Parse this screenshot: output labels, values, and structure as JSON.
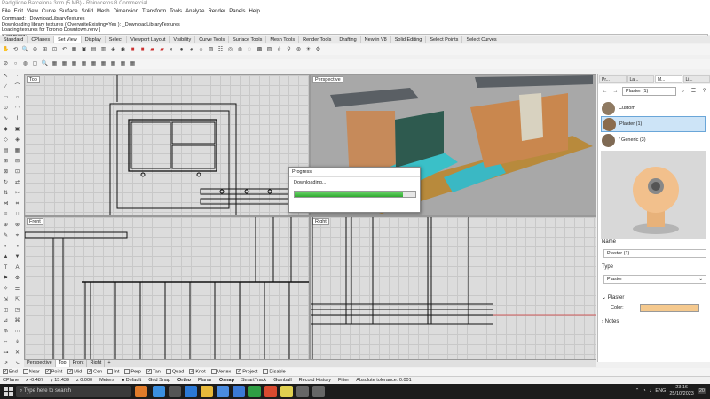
{
  "window": {
    "title": "Padiglione Barcelona 3dm (5 MB) - Rhinoceros 8 Commercial"
  },
  "menu": [
    "File",
    "Edit",
    "View",
    "Curve",
    "Surface",
    "Solid",
    "Mesh",
    "Dimension",
    "Transform",
    "Tools",
    "Analyze",
    "Render",
    "Panels",
    "Help"
  ],
  "command_history": [
    "Command: _DownloadLibraryTextures",
    "Downloading library textures ( OverwriteExisting=Yes ): _DownloadLibraryTextures",
    "Loading textures for Toronto Downtown.renv ]"
  ],
  "command_prompt": "Command:",
  "toolbar_tabs": [
    "Standard",
    "CPlanes",
    "Set View",
    "Display",
    "Select",
    "Viewport Layout",
    "Visibility",
    "Curve Tools",
    "Surface Tools",
    "Mesh Tools",
    "Render Tools",
    "Drafting",
    "New in V8",
    "Solid Editing",
    "Select Points",
    "Select Curves"
  ],
  "active_toolbar_tab": "Set View",
  "viewports": {
    "top": "Top",
    "perspective": "Perspective",
    "front": "Front",
    "right": "Right"
  },
  "viewport_tabs": [
    "Perspective",
    "Top",
    "Front",
    "Right"
  ],
  "active_viewport_tab": "Top",
  "progress": {
    "title": "Progress",
    "message": "Downloading...",
    "percent": 90
  },
  "right_panel": {
    "tabs": [
      "Pr...",
      "La...",
      "M...",
      "Li..."
    ],
    "selected_material": "Plaster (1)",
    "materials": [
      {
        "name": "Custom",
        "color": "#8f7a62"
      },
      {
        "name": "Plaster (1)",
        "color": "#8a6b4c"
      },
      {
        "name": "/ Generic (3)",
        "color": "#7f6a54"
      }
    ],
    "name_label": "Name",
    "name_value": "Plaster (1)",
    "type_label": "Type",
    "type_value": "Plaster",
    "plaster_section": "Plaster",
    "color_label": "Color:",
    "color_value": "#f5c98e",
    "notes_label": "Notes"
  },
  "osnaps": [
    {
      "label": "End",
      "checked": true
    },
    {
      "label": "Near",
      "checked": false
    },
    {
      "label": "Point",
      "checked": true
    },
    {
      "label": "Mid",
      "checked": true
    },
    {
      "label": "Cen",
      "checked": true
    },
    {
      "label": "Int",
      "checked": false
    },
    {
      "label": "Perp",
      "checked": false
    },
    {
      "label": "Tan",
      "checked": true
    },
    {
      "label": "Quad",
      "checked": false
    },
    {
      "label": "Knot",
      "checked": true
    },
    {
      "label": "Vertex",
      "checked": false
    },
    {
      "label": "Project",
      "checked": true
    },
    {
      "label": "Disable",
      "checked": false
    }
  ],
  "status": {
    "cplane": "CPlane",
    "x": "x -0.487",
    "y": "y 15.439",
    "z": "z 0.000",
    "units": "Meters",
    "layer": "Default",
    "grid_snap": "Grid Snap",
    "ortho": "Ortho",
    "planar": "Planar",
    "osnap": "Osnap",
    "smarttrack": "SmartTrack",
    "gumball": "Gumball",
    "record_history": "Record History",
    "filter": "Filter",
    "tolerance": "Absolute tolerance: 0.001"
  },
  "taskbar": {
    "search_placeholder": "Type here to search",
    "language": "ENG",
    "time": "23:16",
    "date": "25/10/2023",
    "badge": "20"
  }
}
